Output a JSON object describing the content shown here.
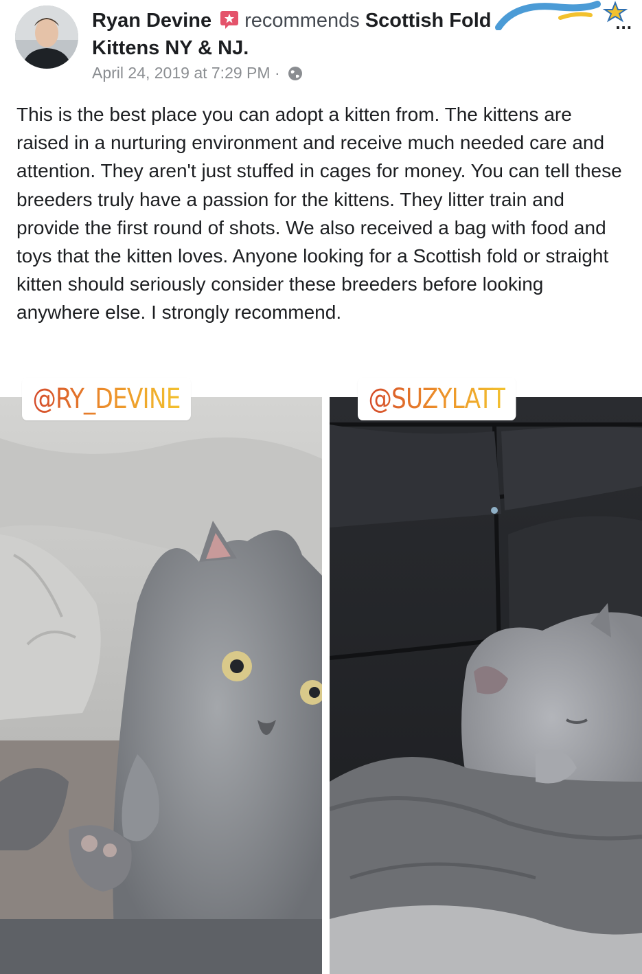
{
  "post": {
    "author": "Ryan Devine",
    "verb": "recommends",
    "page_name_part1": "Scottish Fold",
    "page_name_part2": "Kittens NY & NJ.",
    "timestamp": "April 24, 2019 at 7:29 PM ·",
    "audience_icon": "globe-icon",
    "recommend_icon": "recommend-star-icon",
    "more_icon": "more-options-icon",
    "more_label": "...",
    "review_text": "This is the best place you can adopt a kitten from. The kittens are raised in a nurturing environment and receive much needed care and attention. They aren't just stuffed in cages for money. You can tell these breeders truly have a passion for the kittens. They litter train and provide the first round of shots. We also received a bag with food and toys that the kitten loves. Anyone looking for a Scottish fold or straight kitten should seriously consider these breeders before looking anywhere else. I strongly recommend."
  },
  "photos": {
    "left_tag": "@RY_DEVINE",
    "right_tag": "@SUZYLATT"
  },
  "colors": {
    "text": "#1c1e21",
    "secondary": "#8a8d91",
    "badge": "#e4536b",
    "tag_gradient_start": "#d44a2a",
    "tag_gradient_end": "#f2c12e"
  }
}
